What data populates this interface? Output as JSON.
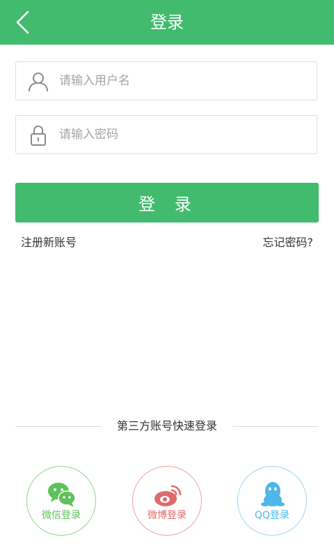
{
  "header": {
    "title": "登录",
    "back_icon": "chevron-left-icon"
  },
  "form": {
    "username": {
      "placeholder": "请输入用户名",
      "value": "",
      "icon": "user-icon"
    },
    "password": {
      "placeholder": "请输入密码",
      "value": "",
      "icon": "lock-icon"
    },
    "login_label": "登 录"
  },
  "links": {
    "register": "注册新账号",
    "forgot": "忘记密码?"
  },
  "third_party": {
    "title": "第三方账号快速登录",
    "options": [
      {
        "label": "微信登录",
        "icon": "wechat-icon",
        "color": "#5ec25a"
      },
      {
        "label": "微博登录",
        "icon": "weibo-icon",
        "color": "#e06a6a"
      },
      {
        "label": "QQ登录",
        "icon": "qq-icon",
        "color": "#4fb7e6"
      }
    ]
  },
  "colors": {
    "accent": "#43bb6f",
    "input_border": "#dedede"
  }
}
